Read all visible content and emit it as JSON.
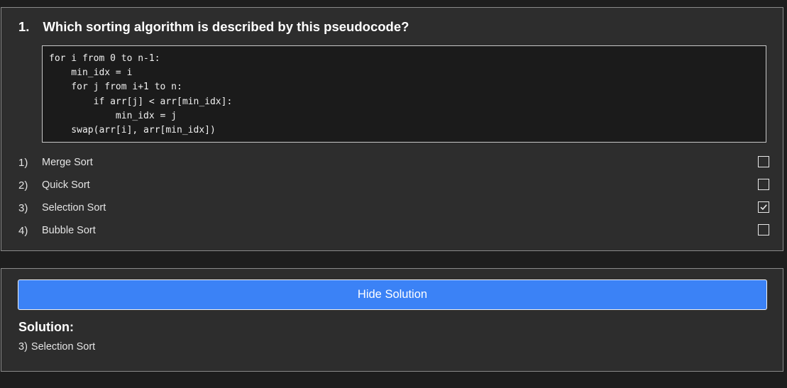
{
  "question": {
    "number": "1.",
    "text": "Which sorting algorithm is described by this pseudocode?",
    "code": "for i from 0 to n-1:\n    min_idx = i\n    for j from i+1 to n:\n        if arr[j] < arr[min_idx]:\n            min_idx = j\n    swap(arr[i], arr[min_idx])"
  },
  "options": [
    {
      "num": "1)",
      "label": "Merge Sort",
      "checked": false
    },
    {
      "num": "2)",
      "label": "Quick Sort",
      "checked": false
    },
    {
      "num": "3)",
      "label": "Selection Sort",
      "checked": true
    },
    {
      "num": "4)",
      "label": "Bubble Sort",
      "checked": false
    }
  ],
  "solution": {
    "button_label": "Hide Solution",
    "title": "Solution:",
    "answer_num": "3)",
    "answer_label": "Selection Sort"
  },
  "colors": {
    "accent": "#3b82f6",
    "background": "#1e1e1e",
    "card": "#2d2d2d",
    "code_bg": "#1b1b1b"
  }
}
